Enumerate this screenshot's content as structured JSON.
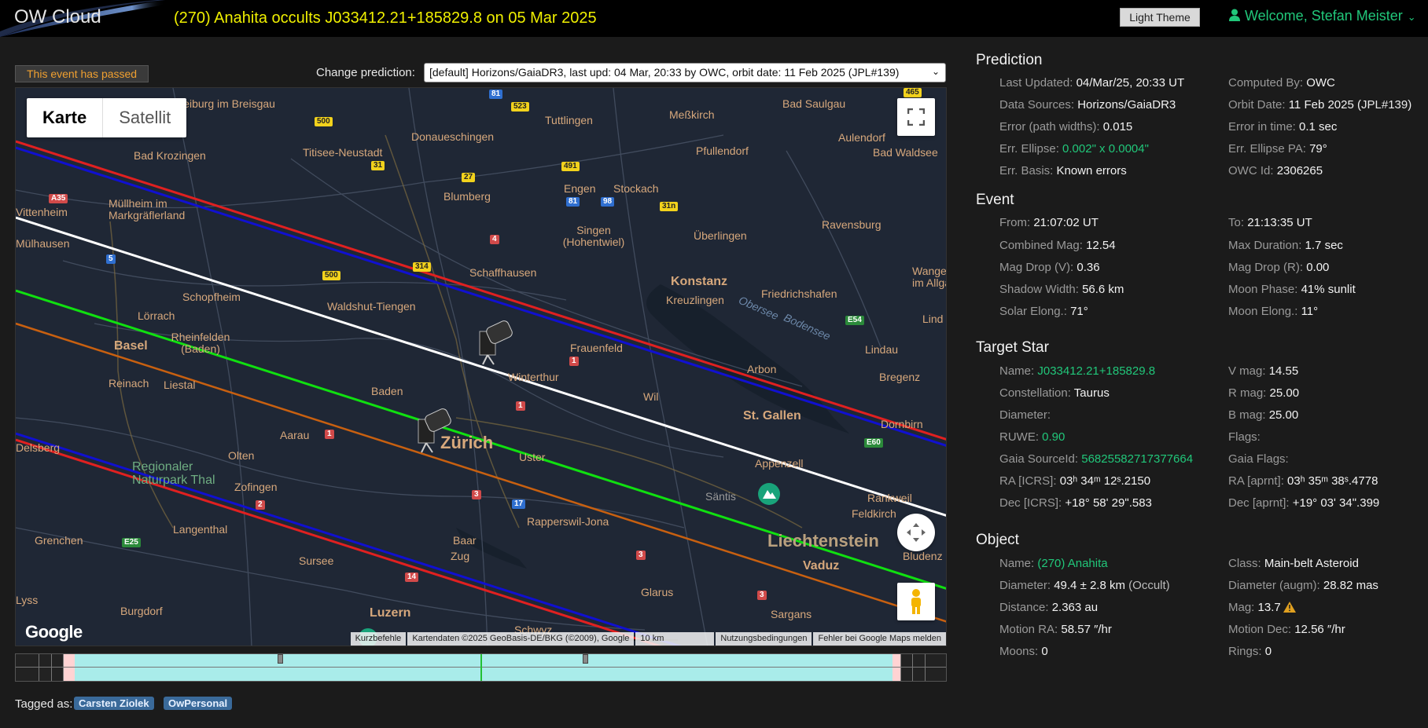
{
  "header": {
    "logo": "OW Cloud",
    "title": "(270) Anahita occults J033412.21+185829.8 on 05 Mar 2025",
    "theme_button": "Light Theme",
    "welcome": "Welcome, Stefan Meister"
  },
  "status": {
    "passed": "This event has passed",
    "change_label": "Change prediction:",
    "prediction_option": "[default] Horizons/GaiaDR3, last upd: 04 Mar, 20:33 by OWC, orbit date: 11 Feb 2025 (JPL#139)"
  },
  "map": {
    "tab_map": "Karte",
    "tab_satellite": "Satellit",
    "google": "Google",
    "attribution": {
      "shortcuts": "Kurzbefehle",
      "data": "Kartendaten ©2025 GeoBasis-DE/BKG (©2009), Google",
      "scale": "10 km",
      "terms": "Nutzungsbedingungen",
      "report": "Fehler bei Google Maps melden"
    },
    "places": {
      "freiburg": "Freiburg im Breisgau",
      "donaueschingen": "Donaueschingen",
      "tuttlingen": "Tuttlingen",
      "messkirch": "Meßkirch",
      "bad_saulgau": "Bad Saulgau",
      "titisee": "Titisee-Neustadt",
      "pfullendorf": "Pfullendorf",
      "aulendorf": "Aulendorf",
      "bad_waldsee": "Bad Waldsee",
      "bad_krozingen": "Bad Krozingen",
      "engen": "Engen",
      "stockach": "Stockach",
      "blumberg": "Blumberg",
      "mullheim": "Müllheim im Markgräflerland",
      "vittenheim": "Vittenheim",
      "singen": "Singen (Hohentwiel)",
      "uberlingen": "Überlingen",
      "ravensburg": "Ravensburg",
      "mulhausen": "Mülhausen",
      "schaffhausen": "Schaffhausen",
      "konstanz": "Konstanz",
      "kreuzlingen": "Kreuzlingen",
      "friedrichshafen": "Friedrichshafen",
      "wangen": "Wange im Allgä",
      "schopfheim": "Schopfheim",
      "waldshut": "Waldshut-Tiengen",
      "lorrach": "Lörrach",
      "basel": "Basel",
      "rheinfelden": "Rheinfelden (Baden)",
      "frauenfeld": "Frauenfeld",
      "obersee": "Obersee",
      "bodensee": "Bodensee",
      "lindau": "Lindau",
      "lind": "Lind",
      "reinach": "Reinach",
      "liestal": "Liestal",
      "winterthur": "Winterthur",
      "arbon": "Arbon",
      "bregenz": "Bregenz",
      "baden": "Baden",
      "wil": "Wil",
      "st_gallen": "St. Gallen",
      "dornbirn": "Dornbirn",
      "delsberg": "Delsberg",
      "aarau": "Aarau",
      "zurich": "Zürich",
      "uster": "Uster",
      "appenzell": "Appenzell",
      "olten": "Olten",
      "regionaler_naturpark": "Regionaler Naturpark Thal",
      "zofingen": "Zofingen",
      "santis": "Säntis",
      "rankweil": "Rankweil",
      "feldkirch": "Feldkirch",
      "rapperswil": "Rapperswil-Jona",
      "langenthal": "Langenthal",
      "liechtenstein": "Liechtenstein",
      "bludenz": "Bludenz",
      "grenchen": "Grenchen",
      "sursee": "Sursee",
      "baar": "Baar",
      "zug": "Zug",
      "vaduz": "Vaduz",
      "lyss": "Lyss",
      "burgdorf": "Burgdorf",
      "luzern": "Luzern",
      "glarus": "Glarus",
      "sargans": "Sargans",
      "schwyz": "Schwyz"
    },
    "roads": {
      "r500a": "500",
      "r523": "523",
      "r81a": "81",
      "r31": "31",
      "r27": "27",
      "r491": "491",
      "r81b": "81",
      "r98": "98",
      "r31n": "31n",
      "r465": "465",
      "a35": "A35",
      "r4": "4",
      "r5": "5",
      "r500b": "500",
      "r314": "314",
      "e54": "E54",
      "r1a": "1",
      "r1b": "1",
      "r1c": "1",
      "e60": "E60",
      "r2": "2",
      "r3a": "3",
      "r17": "17",
      "e25": "E25",
      "r14": "14",
      "r3b": "3",
      "r3c": "3"
    }
  },
  "tags": {
    "label": "Tagged as:",
    "items": [
      "Carsten Ziolek",
      "OwPersonal"
    ]
  },
  "prediction": {
    "title": "Prediction",
    "last_updated_k": "Last Updated:",
    "last_updated_v": "04/Mar/25, 20:33 UT",
    "computed_by_k": "Computed By:",
    "computed_by_v": "OWC",
    "data_sources_k": "Data Sources:",
    "data_sources_v": "Horizons/GaiaDR3",
    "orbit_date_k": "Orbit Date:",
    "orbit_date_v": "11 Feb 2025 (",
    "orbit_date_jpl": "JPL#139",
    "orbit_date_end": ")",
    "err_path_k": "Error (path widths):",
    "err_path_v": "0.015",
    "err_time_k": "Error in time:",
    "err_time_v": "0.1 sec",
    "err_ellipse_k": "Err. Ellipse:",
    "err_ellipse_v": "0.002\" x 0.0004\"",
    "err_ellipse_pa_k": "Err. Ellipse PA:",
    "err_ellipse_pa_v": "79°",
    "err_basis_k": "Err. Basis:",
    "err_basis_v": "Known errors",
    "owc_id_k": "OWC Id:",
    "owc_id_v": "2306265"
  },
  "event": {
    "title": "Event",
    "from_k": "From:",
    "from_v": "21:07:02 UT",
    "to_k": "To:",
    "to_v": "21:13:35 UT",
    "combined_mag_k": "Combined Mag:",
    "combined_mag_v": "12.54",
    "max_duration_k": "Max Duration:",
    "max_duration_v": "1.7 sec",
    "mag_drop_v_k": "Mag Drop (V):",
    "mag_drop_v_v": "0.36",
    "mag_drop_r_k": "Mag Drop (R):",
    "mag_drop_r_v": "0.00",
    "shadow_width_k": "Shadow Width:",
    "shadow_width_v": "56.6 km",
    "moon_phase_k": "Moon Phase:",
    "moon_phase_v": "41% sunlit",
    "solar_elong_k": "Solar Elong.:",
    "solar_elong_v": "71°",
    "moon_elong_k": "Moon Elong.:",
    "moon_elong_v": "11°"
  },
  "target_star": {
    "title": "Target Star",
    "name_k": "Name:",
    "name_v": "J033412.21+185829.8",
    "v_mag_k": "V mag:",
    "v_mag_v": "14.55",
    "constellation_k": "Constellation:",
    "constellation_v": "Taurus",
    "r_mag_k": "R mag:",
    "r_mag_v": "25.00",
    "diameter_k": "Diameter:",
    "b_mag_k": "B mag:",
    "b_mag_v": "25.00",
    "ruwe_k": "RUWE:",
    "ruwe_v": "0.90",
    "flags_k": "Flags:",
    "gaia_source_k": "Gaia SourceId:",
    "gaia_source_v": "56825582717377664",
    "gaia_flags_k": "Gaia Flags:",
    "ra_icrs_k": "RA [ICRS]:",
    "ra_icrs_v": "03ʰ 34ᵐ 12ˢ.2150",
    "ra_aprnt_k": "RA [aprnt]:",
    "ra_aprnt_v": "03ʰ 35ᵐ 38ˢ.4778",
    "dec_icrs_k": "Dec [ICRS]:",
    "dec_icrs_v": "+18° 58ʹ 29ʺ.583",
    "dec_aprnt_k": "Dec [aprnt]:",
    "dec_aprnt_v": "+19° 03ʹ 34ʺ.399"
  },
  "object": {
    "title": "Object",
    "name_k": "Name:",
    "name_v": "(270) Anahita",
    "class_k": "Class:",
    "class_v": "Main-belt Asteroid",
    "diameter_k": "Diameter:",
    "diameter_v": "49.4 ± 2.8 km",
    "diameter_note": "(Occult)",
    "diameter_augm_k": "Diameter (augm):",
    "diameter_augm_v": "28.82 mas",
    "distance_k": "Distance:",
    "distance_v": "2.363 au",
    "mag_k": "Mag:",
    "mag_v": "13.7",
    "motion_ra_k": "Motion RA:",
    "motion_ra_v": "58.57 ″/hr",
    "motion_dec_k": "Motion Dec:",
    "motion_dec_v": "12.56 ″/hr",
    "moons_k": "Moons:",
    "moons_v": "0",
    "rings_k": "Rings:",
    "rings_v": "0"
  },
  "colors": {
    "accent_green": "#21c77a",
    "title_yellow": "#f0f000",
    "path_red": "#e02020",
    "path_blue": "#1010d0",
    "path_white": "#ffffff",
    "path_green": "#10e010",
    "path_orange": "#c86010"
  }
}
